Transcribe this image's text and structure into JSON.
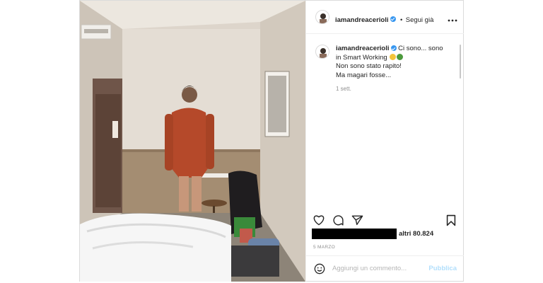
{
  "header": {
    "username": "iamandreacerioli",
    "separator": "•",
    "follow_label": "Segui già",
    "more_icon": "more-horizontal-icon"
  },
  "caption": {
    "username": "iamandreacerioli",
    "line1": "Ci sono... sono",
    "line2": "in Smart Working",
    "line3": "Non sono stato rapito!",
    "line4": "Ma magari fosse...",
    "time": "1 sett."
  },
  "actions": {
    "icons": [
      "heart-icon",
      "comment-icon",
      "share-icon",
      "bookmark-icon"
    ]
  },
  "likes": {
    "text": "altri 80.824"
  },
  "date": "5 MARZO",
  "comment_box": {
    "placeholder": "Aggiungi un commento...",
    "publish_label": "Pubblica"
  },
  "colors": {
    "verified": "#3897f0",
    "publish_disabled": "#b2dffc",
    "shirt": "#b5492a",
    "wall": "#e4ddd4",
    "wood": "#a48d72"
  }
}
